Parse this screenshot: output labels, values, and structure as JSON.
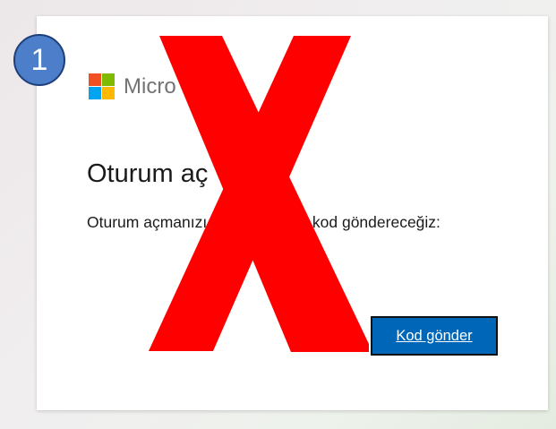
{
  "page": {
    "background": "#eeecee"
  },
  "annotation": {
    "step_number": "1",
    "badge_color": "#4d7ec9",
    "cross_letter": "X",
    "cross_color": "#ff0000"
  },
  "dialog": {
    "brand_name": "Micro",
    "title": "Oturum aç",
    "description": "Oturum açmanızı için şuraya bir kod göndereceğiz:",
    "send_code_button": "Kod gönder",
    "button_color": "#0067b8"
  }
}
